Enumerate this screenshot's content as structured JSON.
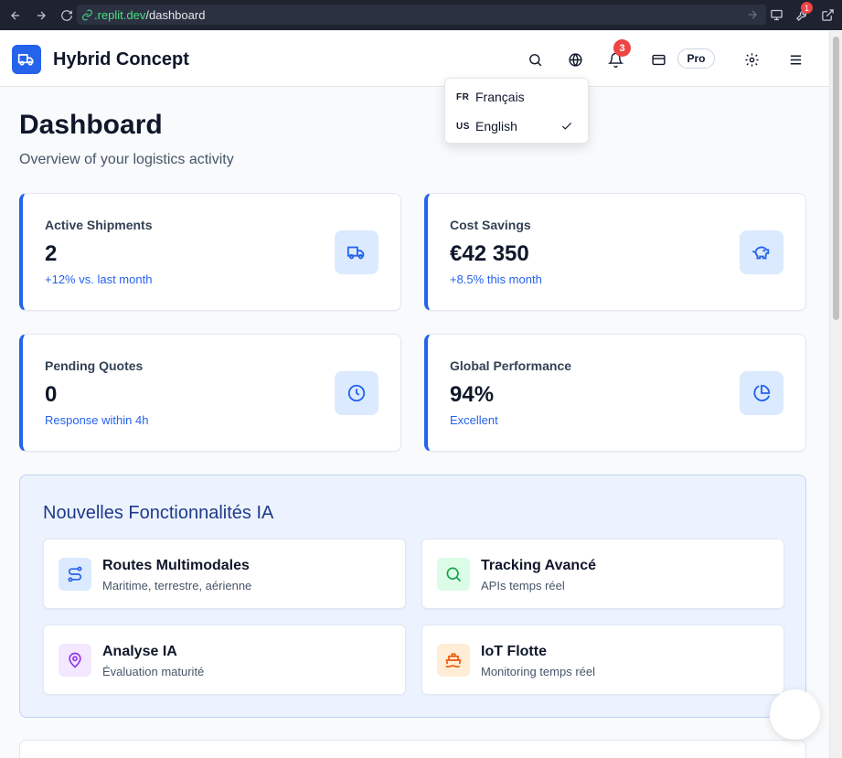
{
  "browser": {
    "url_domain": ".replit.dev",
    "url_path": "/dashboard",
    "extension_badge": "1"
  },
  "header": {
    "brand": "Hybrid Concept",
    "notification_count": "3",
    "plan_badge": "Pro"
  },
  "language_menu": {
    "items": [
      {
        "code": "FR",
        "label": "Français",
        "selected": false
      },
      {
        "code": "US",
        "label": "English",
        "selected": true
      }
    ]
  },
  "page": {
    "title": "Dashboard",
    "subtitle": "Overview of your logistics activity"
  },
  "stats": [
    {
      "label": "Active Shipments",
      "value": "2",
      "note": "+12% vs. last month",
      "icon": "truck-icon"
    },
    {
      "label": "Cost Savings",
      "value": "€42 350",
      "note": "+8.5% this month",
      "icon": "piggy-bank-icon"
    },
    {
      "label": "Pending Quotes",
      "value": "0",
      "note": "Response within 4h",
      "icon": "clock-icon"
    },
    {
      "label": "Global Performance",
      "value": "94%",
      "note": "Excellent",
      "icon": "pie-chart-icon"
    }
  ],
  "features": {
    "title": "Nouvelles Fonctionnalités IA",
    "items": [
      {
        "title": "Routes Multimodales",
        "desc": "Maritime, terrestre, aérienne",
        "icon": "route-icon",
        "color": "#2563eb",
        "bg": "#dbeafe"
      },
      {
        "title": "Tracking Avancé",
        "desc": "APIs temps réel",
        "icon": "search-icon",
        "color": "#16a34a",
        "bg": "#dcfce7"
      },
      {
        "title": "Analyse IA",
        "desc": "Évaluation maturité",
        "icon": "map-pin-icon",
        "color": "#9333ea",
        "bg": "#f3e8ff"
      },
      {
        "title": "IoT Flotte",
        "desc": "Monitoring temps réel",
        "icon": "ship-icon",
        "color": "#ea580c",
        "bg": "#ffedd5"
      }
    ]
  }
}
